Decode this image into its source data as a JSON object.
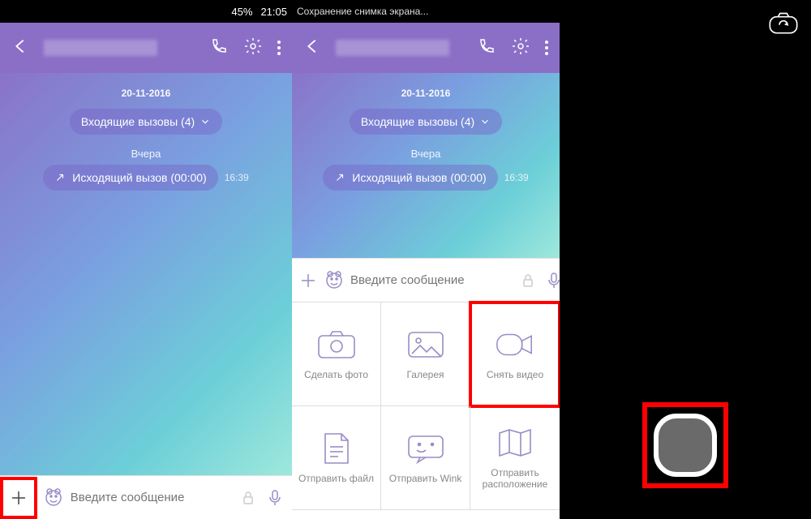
{
  "status": {
    "battery": "45%",
    "time": "21:05",
    "screenshot_msg": "Сохранение снимка экрана..."
  },
  "chat": {
    "date": "20-11-2016",
    "incoming_label": "Входящие вызовы  (4)",
    "yesterday": "Вчера",
    "outgoing": "Исходящий вызов  (00:00)",
    "out_time": "16:39"
  },
  "input": {
    "placeholder": "Введите сообщение"
  },
  "attachments": {
    "photo": "Сделать фото",
    "gallery": "Галерея",
    "video": "Снять видео",
    "file": "Отправить файл",
    "wink": "Отправить Wink",
    "location": "Отправить расположение"
  }
}
